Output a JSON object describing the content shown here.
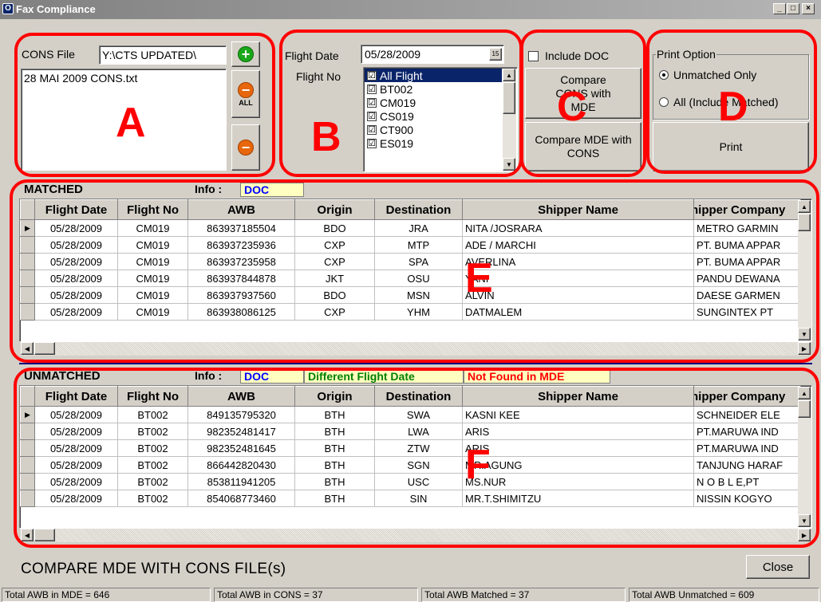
{
  "window": {
    "title": "Fax Compliance",
    "minimize": "_",
    "maximize": "□",
    "close": "×"
  },
  "cons": {
    "label": "CONS File",
    "path_value": "Y:\\CTS UPDATED\\",
    "files": [
      "28 MAI 2009 CONS.txt"
    ],
    "add_icon": "+",
    "remove_all_icon": "−",
    "remove_all_sub": "ALL",
    "remove_icon": "−"
  },
  "flight": {
    "date_label": "Flight Date",
    "date_value": "05/28/2009",
    "calendar_icon": "15",
    "no_label": "Flight No",
    "items": [
      {
        "label": "All Flight",
        "checked": "☑"
      },
      {
        "label": "BT002",
        "checked": "☑"
      },
      {
        "label": "CM019",
        "checked": "☑"
      },
      {
        "label": "CS019",
        "checked": "☑"
      },
      {
        "label": "CT900",
        "checked": "☑"
      },
      {
        "label": "ES019",
        "checked": "☑"
      }
    ]
  },
  "compare": {
    "include_doc_label": "Include DOC",
    "cons_with_mde": "Compare CONS with MDE",
    "mde_with_cons": "Compare MDE with CONS"
  },
  "print": {
    "group_label": "Print Option",
    "opt_unmatched": "Unmatched Only",
    "opt_all": "All (Include Matched)",
    "print_button": "Print"
  },
  "annotations": {
    "A": "A",
    "B": "B",
    "C": "C",
    "D": "D",
    "E": "E",
    "F": "F"
  },
  "columns": [
    "Flight Date",
    "Flight No",
    "AWB",
    "Origin",
    "Destination",
    "Shipper Name",
    "Shipper Company"
  ],
  "matched": {
    "title": "MATCHED",
    "info_label": "Info :",
    "info_doc": "DOC",
    "rows": [
      [
        "05/28/2009",
        "CM019",
        "863937185504",
        "BDO",
        "JRA",
        "NITA /JOSRARA",
        "METRO GARMIN"
      ],
      [
        "05/28/2009",
        "CM019",
        "863937235936",
        "CXP",
        "MTP",
        "ADE / MARCHI",
        "PT. BUMA APPAR"
      ],
      [
        "05/28/2009",
        "CM019",
        "863937235958",
        "CXP",
        "SPA",
        "AVERLINA",
        "PT. BUMA APPAR"
      ],
      [
        "05/28/2009",
        "CM019",
        "863937844878",
        "JKT",
        "OSU",
        "YANI",
        "PANDU DEWANA"
      ],
      [
        "05/28/2009",
        "CM019",
        "863937937560",
        "BDO",
        "MSN",
        "ALVIN",
        "DAESE GARMEN"
      ],
      [
        "05/28/2009",
        "CM019",
        "863938086125",
        "CXP",
        "YHM",
        "DATMALEM",
        "SUNGINTEX PT"
      ]
    ]
  },
  "unmatched": {
    "title": "UNMATCHED",
    "info_label": "Info :",
    "info_doc": "DOC",
    "info_diff_date": "Different Flight Date",
    "info_not_found": "Not Found in MDE",
    "rows": [
      [
        "05/28/2009",
        "BT002",
        "849135795320",
        "BTH",
        "SWA",
        "KASNI KEE",
        "SCHNEIDER ELE"
      ],
      [
        "05/28/2009",
        "BT002",
        "982352481417",
        "BTH",
        "LWA",
        "ARIS",
        "PT.MARUWA IND"
      ],
      [
        "05/28/2009",
        "BT002",
        "982352481645",
        "BTH",
        "ZTW",
        "ARIS",
        "PT.MARUWA IND"
      ],
      [
        "05/28/2009",
        "BT002",
        "866442820430",
        "BTH",
        "SGN",
        "MR.AGUNG",
        "TANJUNG HARAF"
      ],
      [
        "05/28/2009",
        "BT002",
        "853811941205",
        "BTH",
        "USC",
        "MS.NUR",
        "N O B L E,PT"
      ],
      [
        "05/28/2009",
        "BT002",
        "854068773460",
        "BTH",
        "SIN",
        "MR.T.SHIMITZU",
        "NISSIN KOGYO"
      ]
    ]
  },
  "footer": {
    "heading": "COMPARE MDE WITH CONS FILE(s)",
    "close_button": "Close"
  },
  "status": {
    "mde": "Total AWB in MDE = 646",
    "cons": "Total AWB in CONS = 37",
    "matched": "Total AWB Matched = 37",
    "unmatched": "Total AWB Unmatched = 609"
  },
  "colors": {
    "annotation_red": "#ff0000",
    "doc_blue": "#0000ff",
    "diff_date_green": "#008000",
    "not_found_red": "#ff0000",
    "info_bg": "#ffffc0"
  }
}
